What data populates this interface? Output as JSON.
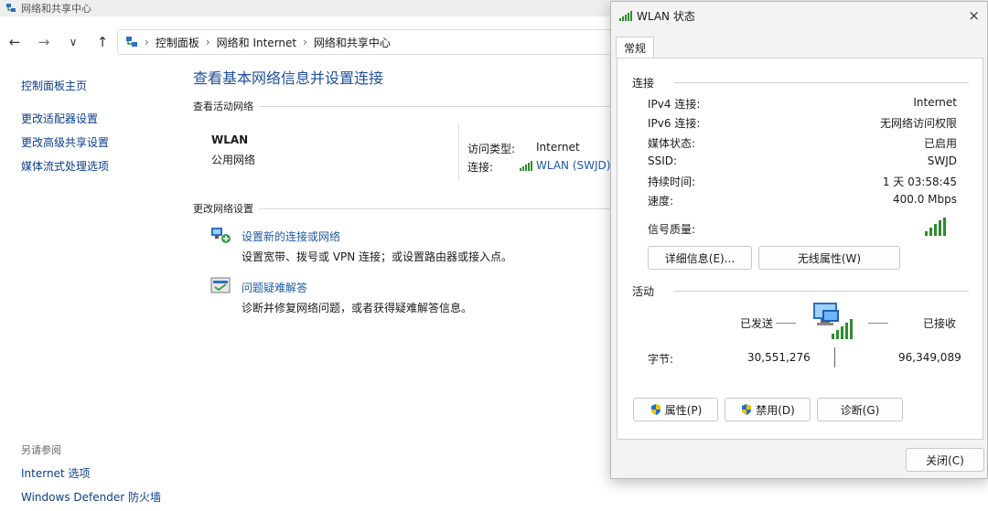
{
  "window": {
    "title": "网络和共享中心"
  },
  "nav": {
    "back": "←",
    "forward": "→",
    "history": "∨",
    "up": "↑"
  },
  "breadcrumb": [
    "控制面板",
    "网络和 Internet",
    "网络和共享中心"
  ],
  "left_pane": {
    "home": "控制面板主页",
    "items": [
      "更改适配器设置",
      "更改高级共享设置",
      "媒体流式处理选项"
    ],
    "see_also_header": "另请参阅",
    "see_also": [
      "Internet 选项",
      "Windows Defender 防火墙"
    ]
  },
  "content": {
    "title": "查看基本网络信息并设置连接",
    "active_header": "查看活动网络",
    "network": {
      "name": "WLAN",
      "type": "公用网络",
      "access_label": "访问类型:",
      "access_value": "Internet",
      "conn_label": "连接:",
      "conn_value": "WLAN (SWJD)"
    },
    "change_header": "更改网络设置",
    "tasks": [
      {
        "link": "设置新的连接或网络",
        "desc": "设置宽带、拨号或 VPN 连接；或设置路由器或接入点。"
      },
      {
        "link": "问题疑难解答",
        "desc": "诊断并修复网络问题，或者获得疑难解答信息。"
      }
    ]
  },
  "dialog": {
    "title": "WLAN 状态",
    "close": "×",
    "tab": "常规",
    "conn_header": "连接",
    "rows": [
      {
        "label": "IPv4 连接:",
        "value": "Internet"
      },
      {
        "label": "IPv6 连接:",
        "value": "无网络访问权限"
      },
      {
        "label": "媒体状态:",
        "value": "已启用"
      },
      {
        "label": "SSID:",
        "value": "SWJD"
      },
      {
        "label": "持续时间:",
        "value": "1 天 03:58:45"
      },
      {
        "label": "速度:",
        "value": "400.0 Mbps"
      }
    ],
    "signal_label": "信号质量:",
    "signal_bars": 5,
    "details_btn": "详细信息(E)...",
    "wireless_btn": "无线属性(W)",
    "activity_header": "活动",
    "sent_label": "已发送",
    "received_label": "已接收",
    "bytes_label": "字节:",
    "bytes_sent": "30,551,276",
    "bytes_received": "96,349,089",
    "properties_btn": "属性(P)",
    "disable_btn": "禁用(D)",
    "diagnose_btn": "诊断(G)",
    "close_btn": "关闭(C)"
  },
  "colors": {
    "link": "#1e5aa8",
    "signal": "#2e8b2e",
    "shield_blue": "#1f6fd1",
    "shield_yellow": "#f2c200"
  }
}
